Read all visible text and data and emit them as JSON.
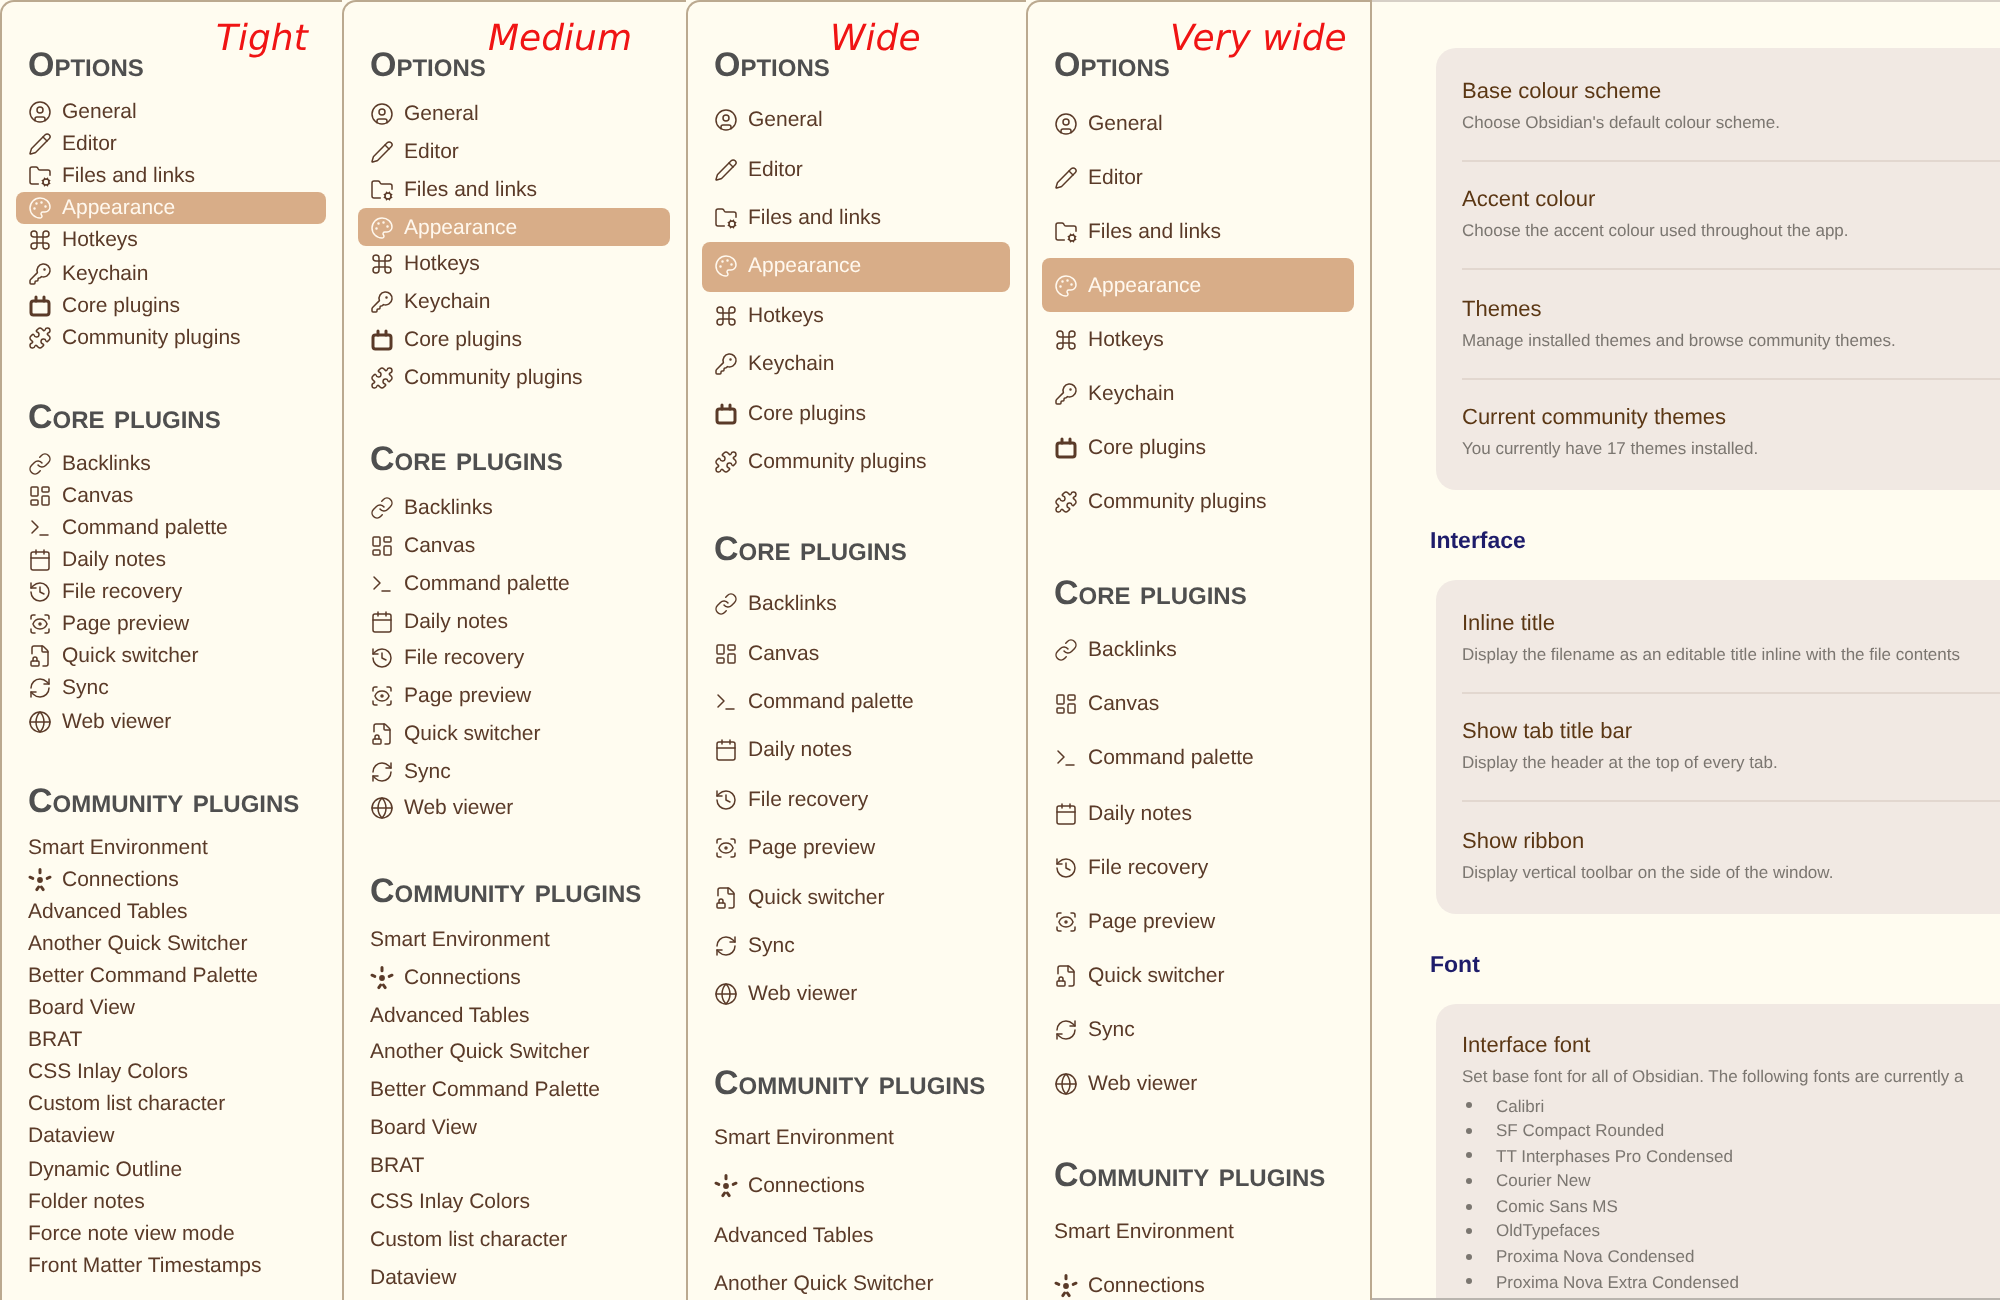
{
  "panels": [
    {
      "annotation": "Tight",
      "sections": [
        {
          "heading": "Options",
          "items": [
            {
              "label": "General",
              "selected": false
            },
            {
              "label": "Editor",
              "selected": false
            },
            {
              "label": "Files and links",
              "selected": false
            },
            {
              "label": "Appearance",
              "selected": true
            },
            {
              "label": "Hotkeys",
              "selected": false
            },
            {
              "label": "Keychain",
              "selected": false
            },
            {
              "label": "Core plugins",
              "selected": false
            },
            {
              "label": "Community plugins",
              "selected": false
            }
          ]
        },
        {
          "heading": "Core plugins",
          "items": [
            {
              "label": "Backlinks",
              "selected": false
            },
            {
              "label": "Canvas",
              "selected": false
            },
            {
              "label": "Command palette",
              "selected": false
            },
            {
              "label": "Daily notes",
              "selected": false
            },
            {
              "label": "File recovery",
              "selected": false
            },
            {
              "label": "Page preview",
              "selected": false
            },
            {
              "label": "Quick switcher",
              "selected": false
            },
            {
              "label": "Sync",
              "selected": false
            },
            {
              "label": "Web viewer",
              "selected": false
            }
          ]
        },
        {
          "heading": "Community plugins",
          "items": [
            {
              "label": "Smart Environment",
              "kind": "plain",
              "selected": false
            },
            {
              "label": "Connections",
              "kind": "icon",
              "selected": false
            },
            {
              "label": "Advanced Tables",
              "kind": "plain",
              "selected": false
            },
            {
              "label": "Another Quick Switcher",
              "kind": "plain",
              "selected": false
            },
            {
              "label": "Better Command Palette",
              "kind": "plain",
              "selected": false
            },
            {
              "label": "Board View",
              "kind": "plain",
              "selected": false
            },
            {
              "label": "BRAT",
              "kind": "plain",
              "selected": false
            },
            {
              "label": "CSS Inlay Colors",
              "kind": "plain",
              "selected": false
            },
            {
              "label": "Custom list character",
              "kind": "plain",
              "selected": false
            },
            {
              "label": "Dataview",
              "kind": "plain",
              "selected": false
            },
            {
              "label": "Dynamic Outline",
              "kind": "plain",
              "selected": false
            },
            {
              "label": "Folder notes",
              "kind": "plain",
              "selected": false
            },
            {
              "label": "Force note view mode",
              "kind": "plain",
              "selected": false
            },
            {
              "label": "Front Matter Timestamps",
              "kind": "plain",
              "selected": false
            }
          ]
        }
      ]
    },
    {
      "annotation": "Medium",
      "sections": [
        {
          "heading": "Options",
          "items": [
            {
              "label": "General",
              "selected": false
            },
            {
              "label": "Editor",
              "selected": false
            },
            {
              "label": "Files and links",
              "selected": false
            },
            {
              "label": "Appearance",
              "selected": true
            },
            {
              "label": "Hotkeys",
              "selected": false
            },
            {
              "label": "Keychain",
              "selected": false
            },
            {
              "label": "Core plugins",
              "selected": false
            },
            {
              "label": "Community plugins",
              "selected": false
            }
          ]
        },
        {
          "heading": "Core plugins",
          "items": [
            {
              "label": "Backlinks",
              "selected": false
            },
            {
              "label": "Canvas",
              "selected": false
            },
            {
              "label": "Command palette",
              "selected": false
            },
            {
              "label": "Daily notes",
              "selected": false
            },
            {
              "label": "File recovery",
              "selected": false
            },
            {
              "label": "Page preview",
              "selected": false
            },
            {
              "label": "Quick switcher",
              "selected": false
            },
            {
              "label": "Sync",
              "selected": false
            },
            {
              "label": "Web viewer",
              "selected": false
            }
          ]
        },
        {
          "heading": "Community plugins",
          "items": [
            {
              "label": "Smart Environment",
              "kind": "plain",
              "selected": false
            },
            {
              "label": "Connections",
              "kind": "icon",
              "selected": false
            },
            {
              "label": "Advanced Tables",
              "kind": "plain",
              "selected": false
            },
            {
              "label": "Another Quick Switcher",
              "kind": "plain",
              "selected": false
            },
            {
              "label": "Better Command Palette",
              "kind": "plain",
              "selected": false
            },
            {
              "label": "Board View",
              "kind": "plain",
              "selected": false
            },
            {
              "label": "BRAT",
              "kind": "plain",
              "selected": false
            },
            {
              "label": "CSS Inlay Colors",
              "kind": "plain",
              "selected": false
            },
            {
              "label": "Custom list character",
              "kind": "plain",
              "selected": false
            },
            {
              "label": "Dataview",
              "kind": "plain",
              "selected": false
            }
          ]
        }
      ]
    },
    {
      "annotation": "Wide",
      "sections": [
        {
          "heading": "Options",
          "items": [
            {
              "label": "General",
              "selected": false
            },
            {
              "label": "Editor",
              "selected": false
            },
            {
              "label": "Files and links",
              "selected": false
            },
            {
              "label": "Appearance",
              "selected": true
            },
            {
              "label": "Hotkeys",
              "selected": false
            },
            {
              "label": "Keychain",
              "selected": false
            },
            {
              "label": "Core plugins",
              "selected": false
            },
            {
              "label": "Community plugins",
              "selected": false
            }
          ]
        },
        {
          "heading": "Core plugins",
          "items": [
            {
              "label": "Backlinks",
              "selected": false
            },
            {
              "label": "Canvas",
              "selected": false
            },
            {
              "label": "Command palette",
              "selected": false
            },
            {
              "label": "Daily notes",
              "selected": false
            },
            {
              "label": "File recovery",
              "selected": false
            },
            {
              "label": "Page preview",
              "selected": false
            },
            {
              "label": "Quick switcher",
              "selected": false
            },
            {
              "label": "Sync",
              "selected": false
            },
            {
              "label": "Web viewer",
              "selected": false
            }
          ]
        },
        {
          "heading": "Community plugins",
          "items": [
            {
              "label": "Smart Environment",
              "kind": "plain",
              "selected": false
            },
            {
              "label": "Connections",
              "kind": "icon",
              "selected": false
            },
            {
              "label": "Advanced Tables",
              "kind": "plain",
              "selected": false
            },
            {
              "label": "Another Quick Switcher",
              "kind": "plain",
              "selected": false
            }
          ]
        }
      ]
    },
    {
      "annotation": "Very wide",
      "sections": [
        {
          "heading": "Options",
          "items": [
            {
              "label": "General",
              "selected": false
            },
            {
              "label": "Editor",
              "selected": false
            },
            {
              "label": "Files and links",
              "selected": false
            },
            {
              "label": "Appearance",
              "selected": true
            },
            {
              "label": "Hotkeys",
              "selected": false
            },
            {
              "label": "Keychain",
              "selected": false
            },
            {
              "label": "Core plugins",
              "selected": false
            },
            {
              "label": "Community plugins",
              "selected": false
            }
          ]
        },
        {
          "heading": "Core plugins",
          "items": [
            {
              "label": "Backlinks",
              "selected": false
            },
            {
              "label": "Canvas",
              "selected": false
            },
            {
              "label": "Command palette",
              "selected": false
            },
            {
              "label": "Daily notes",
              "selected": false
            },
            {
              "label": "File recovery",
              "selected": false
            },
            {
              "label": "Page preview",
              "selected": false
            },
            {
              "label": "Quick switcher",
              "selected": false
            },
            {
              "label": "Sync",
              "selected": false
            },
            {
              "label": "Web viewer",
              "selected": false
            }
          ]
        },
        {
          "heading": "Community plugins",
          "items": [
            {
              "label": "Smart Environment",
              "kind": "plain",
              "selected": false
            },
            {
              "label": "Connections",
              "kind": "icon",
              "selected": false
            }
          ]
        }
      ]
    }
  ],
  "settings": {
    "groups": [
      {
        "settings": [
          {
            "title": "Base colour scheme",
            "description": "Choose Obsidian's default colour scheme."
          },
          {
            "title": "Accent colour",
            "description": "Choose the accent colour used throughout the app."
          },
          {
            "title": "Themes",
            "description": "Manage installed themes and browse community themes."
          },
          {
            "title": "Current community themes",
            "description": "You currently have 17 themes installed."
          }
        ]
      },
      {
        "heading": "Interface",
        "settings": [
          {
            "title": "Inline title",
            "description": "Display the filename as an editable title inline with the file contents"
          },
          {
            "title": "Show tab title bar",
            "description": "Display the header at the top of every tab."
          },
          {
            "title": "Show ribbon",
            "description": "Display vertical toolbar on the side of the window."
          }
        ]
      },
      {
        "heading": "Font",
        "settings": [
          {
            "title": "Interface font",
            "description": "Set base font for all of Obsidian. The following fonts are currently a",
            "fonts": [
              "Calibri",
              "SF Compact Rounded",
              "TT Interphases Pro Condensed",
              "Courier New",
              "Comic Sans MS",
              "OldTypefaces",
              "Proxima Nova Condensed",
              "Proxima Nova Extra Condensed"
            ]
          }
        ]
      }
    ]
  }
}
